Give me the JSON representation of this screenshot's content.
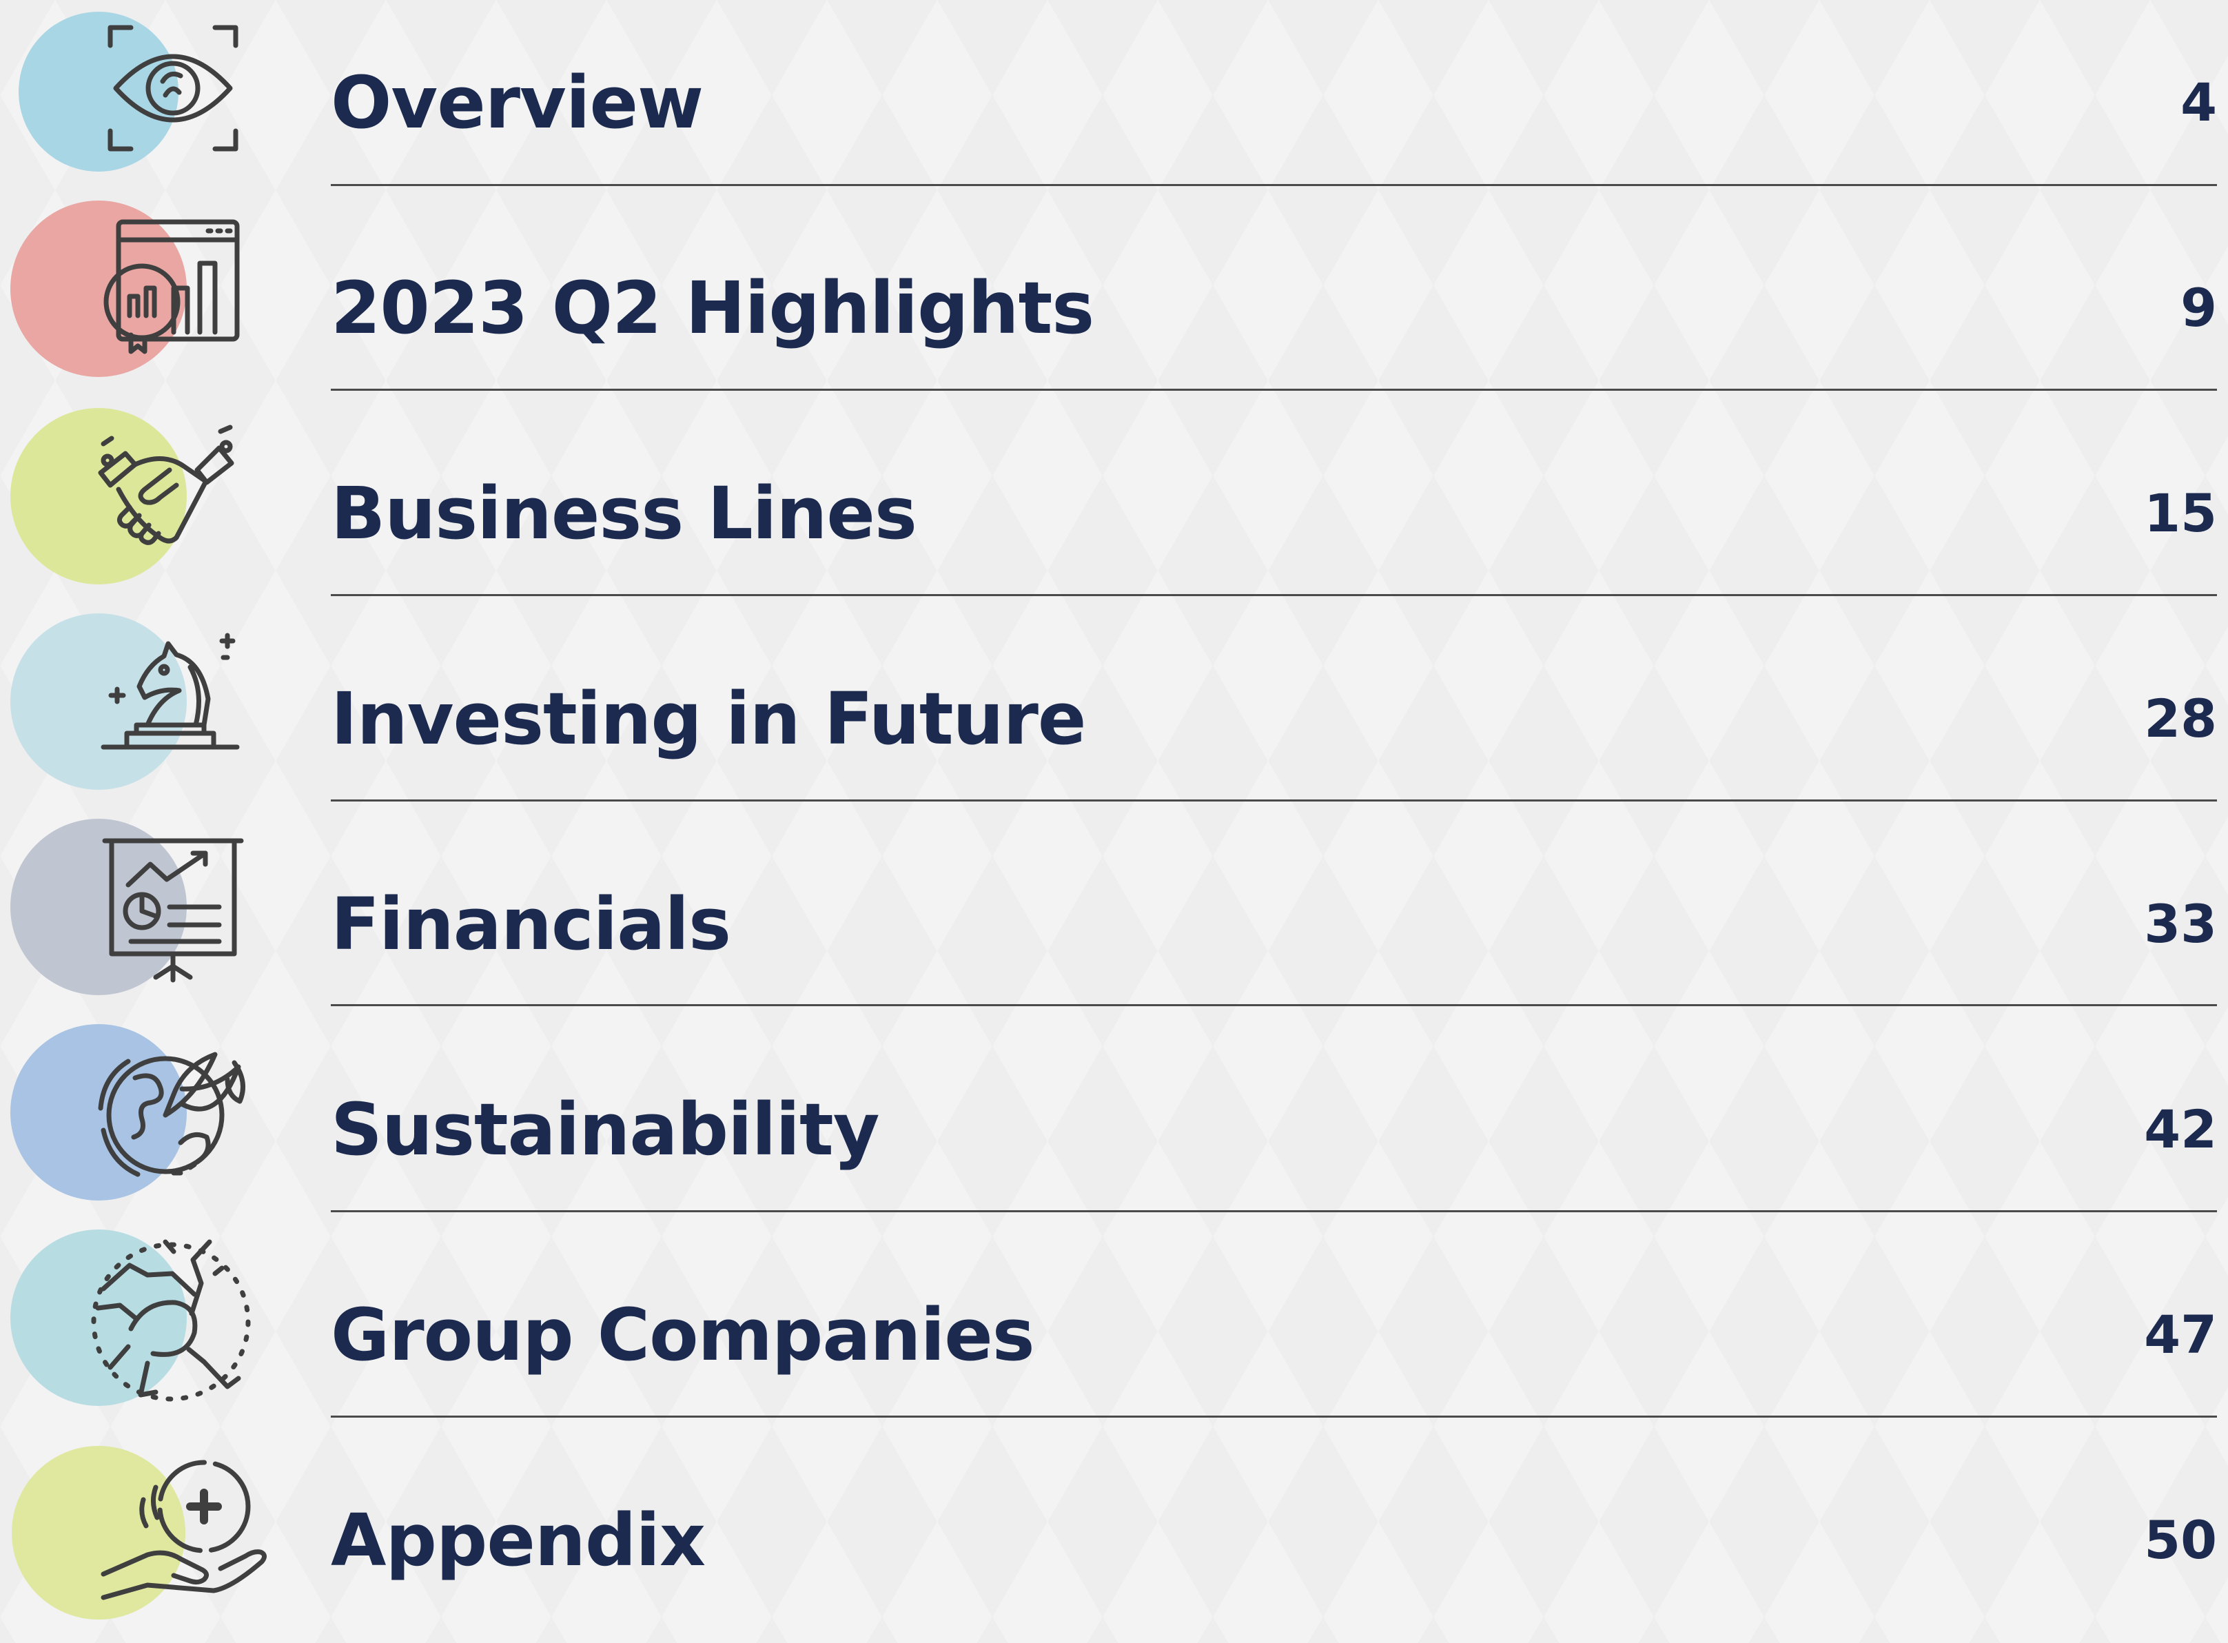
{
  "toc": {
    "items": [
      {
        "title": "Overview",
        "page": "4",
        "circle_color": "#a9d6e5",
        "icon": "eye-scan-icon"
      },
      {
        "title": "2023 Q2 Highlights",
        "page": "9",
        "circle_color": "#e9a6a3",
        "icon": "analytics-dashboard-icon"
      },
      {
        "title": "Business Lines",
        "page": "15",
        "circle_color": "#dde79a",
        "icon": "handshake-icon"
      },
      {
        "title": "Investing in Future",
        "page": "28",
        "circle_color": "#c6e0e8",
        "icon": "chess-knight-icon"
      },
      {
        "title": "Financials",
        "page": "33",
        "circle_color": "#bfc5d1",
        "icon": "presentation-board-icon"
      },
      {
        "title": "Sustainability",
        "page": "42",
        "circle_color": "#a8c3e3",
        "icon": "earth-leaf-icon"
      },
      {
        "title": "Group Companies",
        "page": "47",
        "circle_color": "#b7dde3",
        "icon": "teamwork-hands-icon"
      },
      {
        "title": "Appendix",
        "page": "50",
        "circle_color": "#e0e89f",
        "icon": "hand-medical-icon"
      }
    ]
  }
}
